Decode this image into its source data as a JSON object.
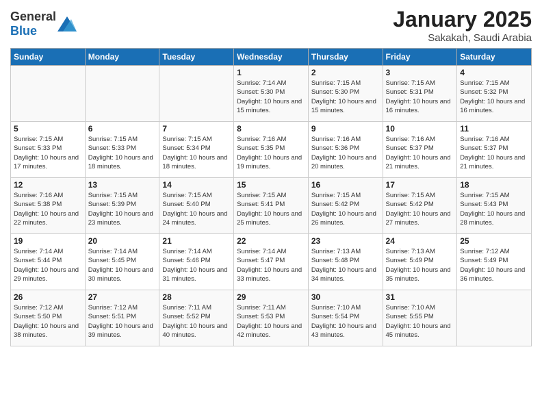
{
  "header": {
    "logo_general": "General",
    "logo_blue": "Blue",
    "month": "January 2025",
    "location": "Sakakah, Saudi Arabia"
  },
  "weekdays": [
    "Sunday",
    "Monday",
    "Tuesday",
    "Wednesday",
    "Thursday",
    "Friday",
    "Saturday"
  ],
  "weeks": [
    [
      {
        "day": "",
        "sunrise": "",
        "sunset": "",
        "daylight": ""
      },
      {
        "day": "",
        "sunrise": "",
        "sunset": "",
        "daylight": ""
      },
      {
        "day": "",
        "sunrise": "",
        "sunset": "",
        "daylight": ""
      },
      {
        "day": "1",
        "sunrise": "Sunrise: 7:14 AM",
        "sunset": "Sunset: 5:30 PM",
        "daylight": "Daylight: 10 hours and 15 minutes."
      },
      {
        "day": "2",
        "sunrise": "Sunrise: 7:15 AM",
        "sunset": "Sunset: 5:30 PM",
        "daylight": "Daylight: 10 hours and 15 minutes."
      },
      {
        "day": "3",
        "sunrise": "Sunrise: 7:15 AM",
        "sunset": "Sunset: 5:31 PM",
        "daylight": "Daylight: 10 hours and 16 minutes."
      },
      {
        "day": "4",
        "sunrise": "Sunrise: 7:15 AM",
        "sunset": "Sunset: 5:32 PM",
        "daylight": "Daylight: 10 hours and 16 minutes."
      }
    ],
    [
      {
        "day": "5",
        "sunrise": "Sunrise: 7:15 AM",
        "sunset": "Sunset: 5:33 PM",
        "daylight": "Daylight: 10 hours and 17 minutes."
      },
      {
        "day": "6",
        "sunrise": "Sunrise: 7:15 AM",
        "sunset": "Sunset: 5:33 PM",
        "daylight": "Daylight: 10 hours and 18 minutes."
      },
      {
        "day": "7",
        "sunrise": "Sunrise: 7:15 AM",
        "sunset": "Sunset: 5:34 PM",
        "daylight": "Daylight: 10 hours and 18 minutes."
      },
      {
        "day": "8",
        "sunrise": "Sunrise: 7:16 AM",
        "sunset": "Sunset: 5:35 PM",
        "daylight": "Daylight: 10 hours and 19 minutes."
      },
      {
        "day": "9",
        "sunrise": "Sunrise: 7:16 AM",
        "sunset": "Sunset: 5:36 PM",
        "daylight": "Daylight: 10 hours and 20 minutes."
      },
      {
        "day": "10",
        "sunrise": "Sunrise: 7:16 AM",
        "sunset": "Sunset: 5:37 PM",
        "daylight": "Daylight: 10 hours and 21 minutes."
      },
      {
        "day": "11",
        "sunrise": "Sunrise: 7:16 AM",
        "sunset": "Sunset: 5:37 PM",
        "daylight": "Daylight: 10 hours and 21 minutes."
      }
    ],
    [
      {
        "day": "12",
        "sunrise": "Sunrise: 7:16 AM",
        "sunset": "Sunset: 5:38 PM",
        "daylight": "Daylight: 10 hours and 22 minutes."
      },
      {
        "day": "13",
        "sunrise": "Sunrise: 7:15 AM",
        "sunset": "Sunset: 5:39 PM",
        "daylight": "Daylight: 10 hours and 23 minutes."
      },
      {
        "day": "14",
        "sunrise": "Sunrise: 7:15 AM",
        "sunset": "Sunset: 5:40 PM",
        "daylight": "Daylight: 10 hours and 24 minutes."
      },
      {
        "day": "15",
        "sunrise": "Sunrise: 7:15 AM",
        "sunset": "Sunset: 5:41 PM",
        "daylight": "Daylight: 10 hours and 25 minutes."
      },
      {
        "day": "16",
        "sunrise": "Sunrise: 7:15 AM",
        "sunset": "Sunset: 5:42 PM",
        "daylight": "Daylight: 10 hours and 26 minutes."
      },
      {
        "day": "17",
        "sunrise": "Sunrise: 7:15 AM",
        "sunset": "Sunset: 5:42 PM",
        "daylight": "Daylight: 10 hours and 27 minutes."
      },
      {
        "day": "18",
        "sunrise": "Sunrise: 7:15 AM",
        "sunset": "Sunset: 5:43 PM",
        "daylight": "Daylight: 10 hours and 28 minutes."
      }
    ],
    [
      {
        "day": "19",
        "sunrise": "Sunrise: 7:14 AM",
        "sunset": "Sunset: 5:44 PM",
        "daylight": "Daylight: 10 hours and 29 minutes."
      },
      {
        "day": "20",
        "sunrise": "Sunrise: 7:14 AM",
        "sunset": "Sunset: 5:45 PM",
        "daylight": "Daylight: 10 hours and 30 minutes."
      },
      {
        "day": "21",
        "sunrise": "Sunrise: 7:14 AM",
        "sunset": "Sunset: 5:46 PM",
        "daylight": "Daylight: 10 hours and 31 minutes."
      },
      {
        "day": "22",
        "sunrise": "Sunrise: 7:14 AM",
        "sunset": "Sunset: 5:47 PM",
        "daylight": "Daylight: 10 hours and 33 minutes."
      },
      {
        "day": "23",
        "sunrise": "Sunrise: 7:13 AM",
        "sunset": "Sunset: 5:48 PM",
        "daylight": "Daylight: 10 hours and 34 minutes."
      },
      {
        "day": "24",
        "sunrise": "Sunrise: 7:13 AM",
        "sunset": "Sunset: 5:49 PM",
        "daylight": "Daylight: 10 hours and 35 minutes."
      },
      {
        "day": "25",
        "sunrise": "Sunrise: 7:12 AM",
        "sunset": "Sunset: 5:49 PM",
        "daylight": "Daylight: 10 hours and 36 minutes."
      }
    ],
    [
      {
        "day": "26",
        "sunrise": "Sunrise: 7:12 AM",
        "sunset": "Sunset: 5:50 PM",
        "daylight": "Daylight: 10 hours and 38 minutes."
      },
      {
        "day": "27",
        "sunrise": "Sunrise: 7:12 AM",
        "sunset": "Sunset: 5:51 PM",
        "daylight": "Daylight: 10 hours and 39 minutes."
      },
      {
        "day": "28",
        "sunrise": "Sunrise: 7:11 AM",
        "sunset": "Sunset: 5:52 PM",
        "daylight": "Daylight: 10 hours and 40 minutes."
      },
      {
        "day": "29",
        "sunrise": "Sunrise: 7:11 AM",
        "sunset": "Sunset: 5:53 PM",
        "daylight": "Daylight: 10 hours and 42 minutes."
      },
      {
        "day": "30",
        "sunrise": "Sunrise: 7:10 AM",
        "sunset": "Sunset: 5:54 PM",
        "daylight": "Daylight: 10 hours and 43 minutes."
      },
      {
        "day": "31",
        "sunrise": "Sunrise: 7:10 AM",
        "sunset": "Sunset: 5:55 PM",
        "daylight": "Daylight: 10 hours and 45 minutes."
      },
      {
        "day": "",
        "sunrise": "",
        "sunset": "",
        "daylight": ""
      }
    ]
  ]
}
